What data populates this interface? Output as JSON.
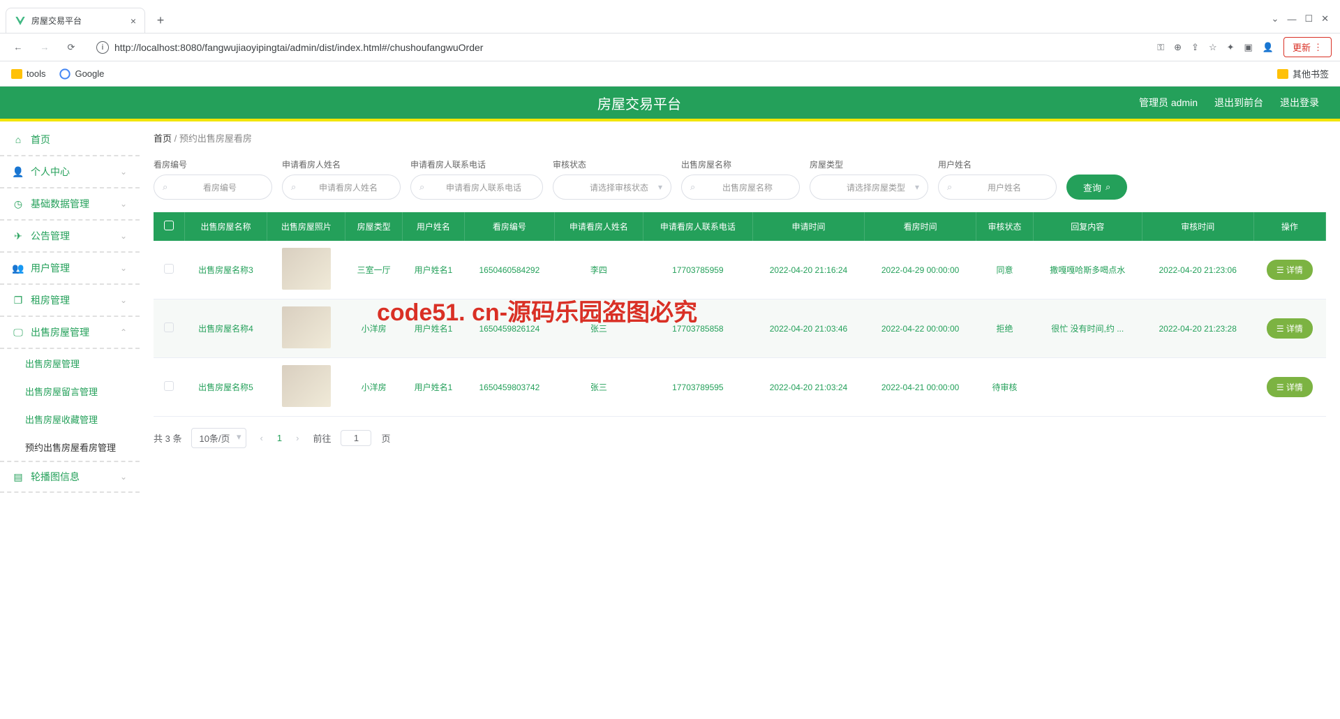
{
  "browser": {
    "tab_title": "房屋交易平台",
    "url": "http://localhost:8080/fangwujiaoyipingtai/admin/dist/index.html#/chushoufangwuOrder",
    "update_label": "更新",
    "bookmarks": {
      "tools": "tools",
      "google": "Google",
      "other": "其他书签"
    }
  },
  "header": {
    "title": "房屋交易平台",
    "user": "管理员 admin",
    "to_front": "退出到前台",
    "logout": "退出登录"
  },
  "sidebar": {
    "home": "首页",
    "personal": "个人中心",
    "basic": "基础数据管理",
    "notice": "公告管理",
    "users": "用户管理",
    "rent": "租房管理",
    "sale": "出售房屋管理",
    "sale_sub": {
      "list": "出售房屋管理",
      "message": "出售房屋留言管理",
      "collect": "出售房屋收藏管理",
      "order": "预约出售房屋看房管理"
    },
    "carousel": "轮播图信息"
  },
  "breadcrumb": {
    "home": "首页",
    "current": "预约出售房屋看房"
  },
  "filters": {
    "code": {
      "label": "看房编号",
      "placeholder": "看房编号"
    },
    "name": {
      "label": "申请看房人姓名",
      "placeholder": "申请看房人姓名"
    },
    "phone": {
      "label": "申请看房人联系电话",
      "placeholder": "申请看房人联系电话"
    },
    "status": {
      "label": "审核状态",
      "placeholder": "请选择审核状态"
    },
    "house": {
      "label": "出售房屋名称",
      "placeholder": "出售房屋名称"
    },
    "type": {
      "label": "房屋类型",
      "placeholder": "请选择房屋类型"
    },
    "user": {
      "label": "用户姓名",
      "placeholder": "用户姓名"
    },
    "query": "查询"
  },
  "table": {
    "headers": [
      "出售房屋名称",
      "出售房屋照片",
      "房屋类型",
      "用户姓名",
      "看房编号",
      "申请看房人姓名",
      "申请看房人联系电话",
      "申请时间",
      "看房时间",
      "审核状态",
      "回复内容",
      "审核时间",
      "操作"
    ],
    "rows": [
      {
        "house": "出售房屋名称3",
        "type": "三室一厅",
        "user": "用户姓名1",
        "code": "1650460584292",
        "applicant": "李四",
        "phone": "17703785959",
        "apply_time": "2022-04-20 21:16:24",
        "view_time": "2022-04-29 00:00:00",
        "status": "同意",
        "reply": "撒嘎嘎哈斯多喝点水",
        "review_time": "2022-04-20 21:23:06",
        "action": "详情"
      },
      {
        "house": "出售房屋名称4",
        "type": "小洋房",
        "user": "用户姓名1",
        "code": "1650459826124",
        "applicant": "张三",
        "phone": "17703785858",
        "apply_time": "2022-04-20 21:03:46",
        "view_time": "2022-04-22 00:00:00",
        "status": "拒绝",
        "reply": "很忙 没有时间,约 ...",
        "review_time": "2022-04-20 21:23:28",
        "action": "详情"
      },
      {
        "house": "出售房屋名称5",
        "type": "小洋房",
        "user": "用户姓名1",
        "code": "1650459803742",
        "applicant": "张三",
        "phone": "17703789595",
        "apply_time": "2022-04-20 21:03:24",
        "view_time": "2022-04-21 00:00:00",
        "status": "待审核",
        "reply": "",
        "review_time": "",
        "action": "详情"
      }
    ]
  },
  "pagination": {
    "total": "共 3 条",
    "page_size": "10条/页",
    "current": "1",
    "goto_prefix": "前往",
    "goto_val": "1",
    "goto_suffix": "页"
  },
  "watermark_red": "code51. cn-源码乐园盗图必究"
}
